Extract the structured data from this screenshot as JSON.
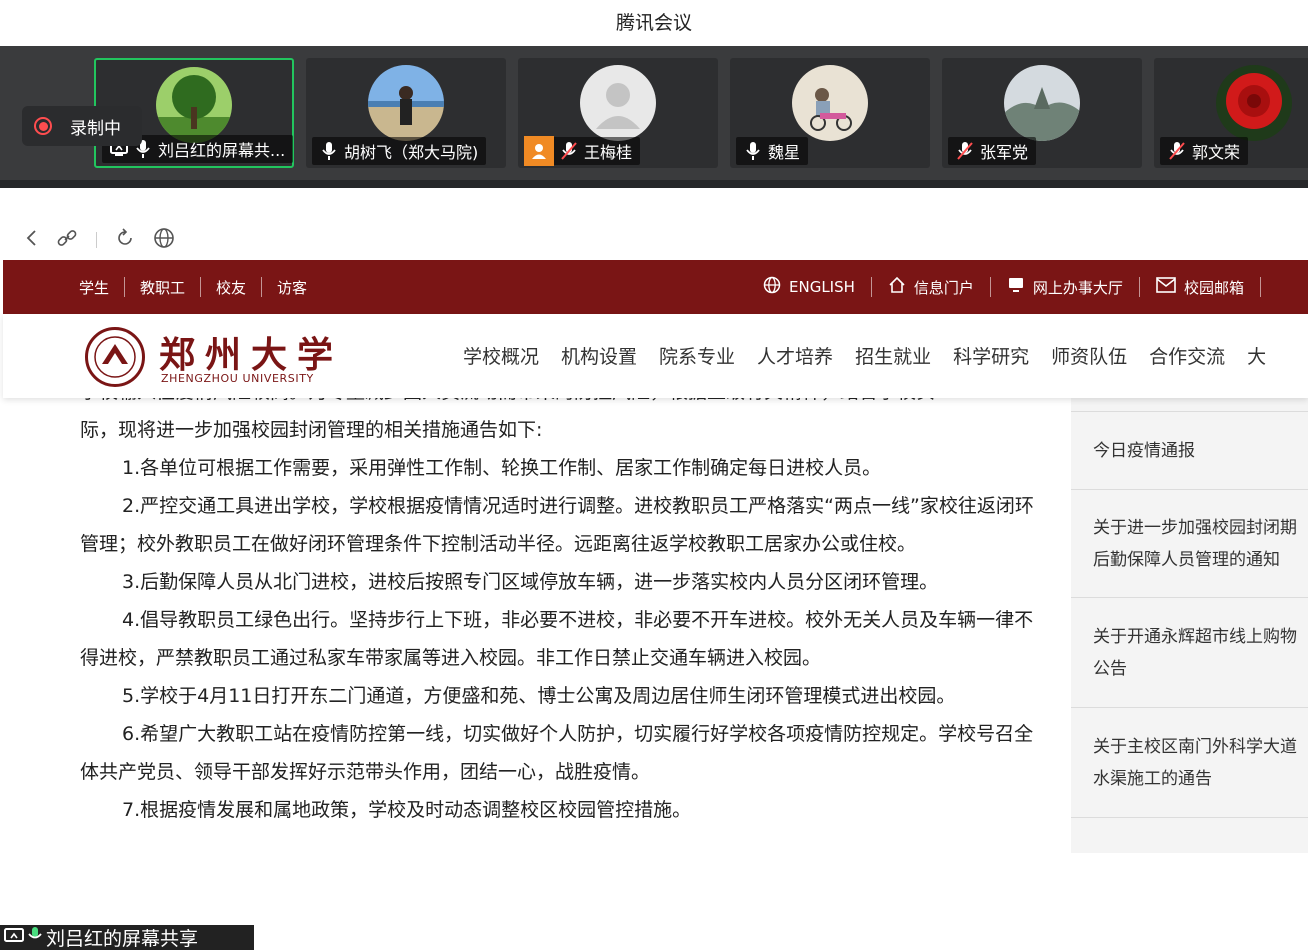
{
  "window": {
    "title": "腾讯会议"
  },
  "recording": {
    "label": "录制中"
  },
  "participants": [
    {
      "name": "刘吕红的屏幕共...",
      "sharing": true,
      "mic": "on"
    },
    {
      "name": "胡树飞（郑大马院)",
      "mic": "on"
    },
    {
      "name": "王梅桂",
      "mic": "muted",
      "badge": true
    },
    {
      "name": "魏星",
      "mic": "on"
    },
    {
      "name": "张军党",
      "mic": "muted"
    },
    {
      "name": "郭文荣",
      "mic": "muted"
    }
  ],
  "site": {
    "top_links": [
      "学生",
      "教职工",
      "校友",
      "访客"
    ],
    "top_right": [
      "ENGLISH",
      "信息门户",
      "网上办事大厅",
      "校园邮箱"
    ],
    "logo_cn": "郑州大学",
    "logo_en": "ZHENGZHOU UNIVERSITY",
    "nav": [
      "学校概况",
      "机构设置",
      "院系专业",
      "人才培养",
      "招生就业",
      "科学研究",
      "师资队伍",
      "合作交流",
      "大"
    ]
  },
  "article": {
    "partial_line": "学校输入性疫情风险较高。为尽量减少因人员流动而带来的防控风险，根据上级有关精神，结合学校实",
    "p0": "际，现将进一步加强校园封闭管理的相关措施通告如下:",
    "p1": "1.各单位可根据工作需要，采用弹性工作制、轮换工作制、居家工作制确定每日进校人员。",
    "p2": "2.严控交通工具进出学校，学校根据疫情情况适时进行调整。进校教职员工严格落实“两点一线”家校往返闭环管理；校外教职员工在做好闭环管理条件下控制活动半径。远距离往返学校教职工居家办公或住校。",
    "p3": "3.后勤保障人员从北门进校，进校后按照专门区域停放车辆，进一步落实校内人员分区闭环管理。",
    "p4": "4.倡导教职员工绿色出行。坚持步行上下班，非必要不进校，非必要不开车进校。校外无关人员及车辆一律不得进校，严禁教职员工通过私家车带家属等进入校园。非工作日禁止交通车辆进入校园。",
    "p5": "5.学校于4月11日打开东二门通道，方便盛和苑、博士公寓及周边居住师生闭环管理模式进出校园。",
    "p6": "6.希望广大教职工站在疫情防控第一线，切实做好个人防护，切实履行好学校各项疫情防控规定。学校号召全体共产党员、领导干部发挥好示范带头作用，团结一心，战胜疫情。",
    "p7": "7.根据疫情发展和属地政策，学校及时动态调整校区校园管控措施。"
  },
  "sidebar": {
    "items": [
      {
        "l1": "今日疫情通报",
        "l2": ""
      },
      {
        "l1": "关于进一步加强校园封闭期",
        "l2": "后勤保障人员管理的通知"
      },
      {
        "l1": "关于开通永辉超市线上购物",
        "l2": "公告"
      },
      {
        "l1": "关于主校区南门外科学大道",
        "l2": "水渠施工的通告"
      }
    ]
  },
  "share": {
    "label": "刘吕红的屏幕共享"
  },
  "colors": {
    "brand": "#7a1515",
    "strip": "#3a3b3d",
    "active_border": "#22c55e",
    "record": "#ff4d4f"
  }
}
